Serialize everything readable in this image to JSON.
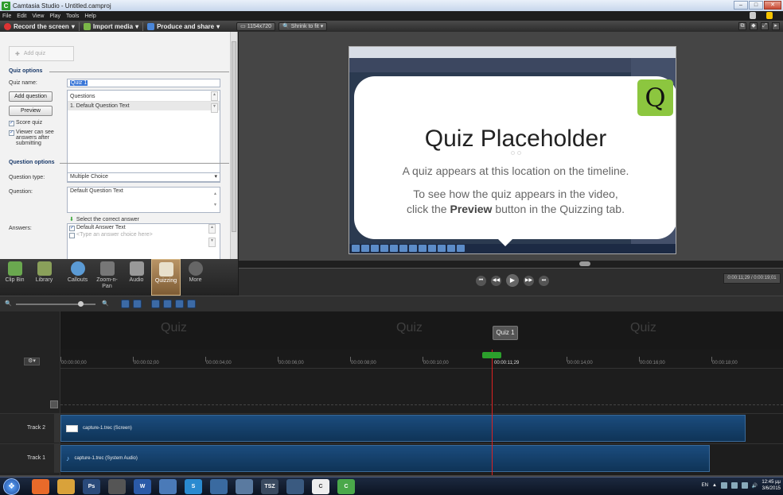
{
  "window": {
    "title": "Camtasia Studio - Untitled.camproj",
    "app_icon": "C"
  },
  "menu": [
    "File",
    "Edit",
    "View",
    "Play",
    "Tools",
    "Help"
  ],
  "toolbar": {
    "record": "Record the screen",
    "import": "Import media",
    "produce": "Produce and share",
    "dimensions": "1154x720",
    "zoom": "Shrink to fit"
  },
  "quiz_panel": {
    "add_quiz": "Add quiz",
    "quiz_options_heading": "Quiz options",
    "quiz_name_label": "Quiz name:",
    "quiz_name_value": "Quiz 1",
    "add_question": "Add question",
    "preview": "Preview",
    "questions_header": "Questions",
    "questions": [
      "1. Default Question Text"
    ],
    "score_quiz": "Score quiz",
    "viewer_answers": "Viewer can see answers after submitting",
    "question_options_heading": "Question options",
    "question_type_label": "Question type:",
    "question_type_value": "Multiple Choice",
    "question_label": "Question:",
    "question_value": "Default Question Text",
    "select_correct": "Select the correct answer",
    "answers_label": "Answers:",
    "answers": [
      "Default Answer Text",
      "<Type an answer choice here>"
    ]
  },
  "preview": {
    "badge": "Q",
    "title": "Quiz Placeholder",
    "line1": "A quiz appears at this location on the timeline.",
    "line2_a": "To see how the quiz appears in the video,",
    "line2_b": "click the",
    "line2_bold": "Preview",
    "line2_c": "button in the Quizzing tab."
  },
  "tool_tabs": [
    {
      "label": "Clip Bin",
      "color": "#6aa84f"
    },
    {
      "label": "Library",
      "color": "#8aa05a"
    },
    {
      "label": "Callouts",
      "color": "#5b9bd5"
    },
    {
      "label": "Zoom-n-Pan",
      "color": "#777777"
    },
    {
      "label": "Audio",
      "color": "#999999"
    },
    {
      "label": "Quizzing",
      "color": "#e8e0cc"
    },
    {
      "label": "More",
      "color": "#666666"
    }
  ],
  "player": {
    "timecode": "0:00:11;29 / 0:00:19;01"
  },
  "timeline": {
    "quiz_labels": [
      "Quiz",
      "Quiz",
      "Quiz"
    ],
    "quiz_marker": "Quiz 1",
    "ruler": [
      "00:00:00;00",
      "00:00:02;00",
      "00:00:04;00",
      "00:00:06;00",
      "00:00:08;00",
      "00:00:10;00",
      "00:00:11;29",
      "00:00:14;00",
      "00:00:16;00",
      "00:00:18;00"
    ],
    "tracks": [
      {
        "name": "Track 2",
        "clip": "capture-1.trec (Screen)"
      },
      {
        "name": "Track 1",
        "clip": "capture-1.trec (System Audio)"
      }
    ]
  },
  "taskbar": {
    "apps": [
      {
        "label": "",
        "color": "#e86a2a"
      },
      {
        "label": "",
        "color": "#d9a23a"
      },
      {
        "label": "Ps",
        "color": "#2a4a7a"
      },
      {
        "label": "",
        "color": "#555555"
      },
      {
        "label": "W",
        "color": "#2b5aa8"
      },
      {
        "label": "",
        "color": "#4a7ab8"
      },
      {
        "label": "S",
        "color": "#2a8ad0"
      },
      {
        "label": "",
        "color": "#3a6aa0"
      },
      {
        "label": "",
        "color": "#5a7aa0"
      },
      {
        "label": "TSZ",
        "color": "#3a4a60"
      },
      {
        "label": "",
        "color": "#3a5a80"
      },
      {
        "label": "C",
        "color": "#eeeeee"
      },
      {
        "label": "C",
        "color": "#4aa84a"
      }
    ],
    "lang": "EN",
    "time": "12:45 μμ",
    "date": "3/6/2015"
  }
}
